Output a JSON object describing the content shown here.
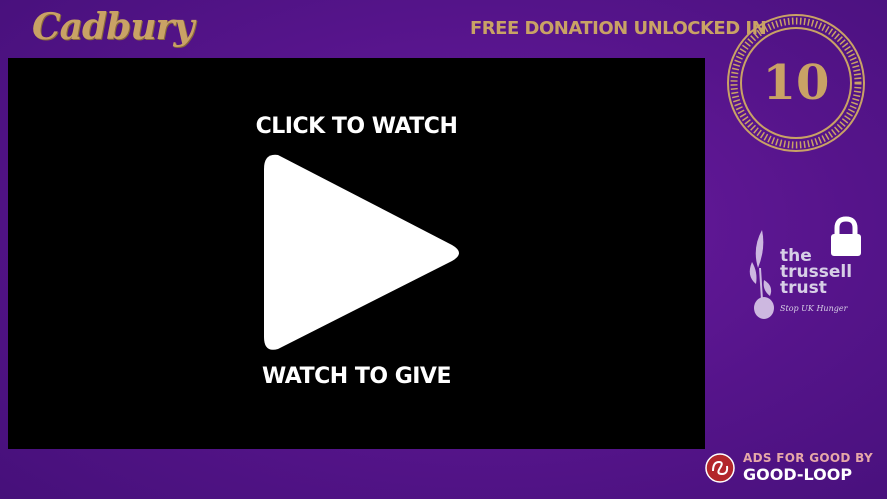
{
  "brand": {
    "logo_text": "Cadbury"
  },
  "header": {
    "donation_text": "FREE DONATION UNLOCKED IN"
  },
  "countdown": {
    "seconds": "10"
  },
  "video": {
    "click_prompt": "CLICK TO WATCH",
    "give_prompt": "WATCH TO GIVE",
    "play_icon": "play-icon"
  },
  "charity": {
    "name_line1": "the",
    "name_line2": "trussell",
    "name_line3": "trust",
    "tagline": "Stop UK Hunger",
    "status_icon": "lock-icon"
  },
  "footer": {
    "badge_line1": "ADS FOR GOOD BY",
    "badge_line2": "GOOD-LOOP"
  },
  "colors": {
    "background": "#55148a",
    "gold": "#c9a265",
    "video_bg": "#000000",
    "charity_text": "#d7cfe6",
    "goodloop_red": "#b3262b"
  }
}
